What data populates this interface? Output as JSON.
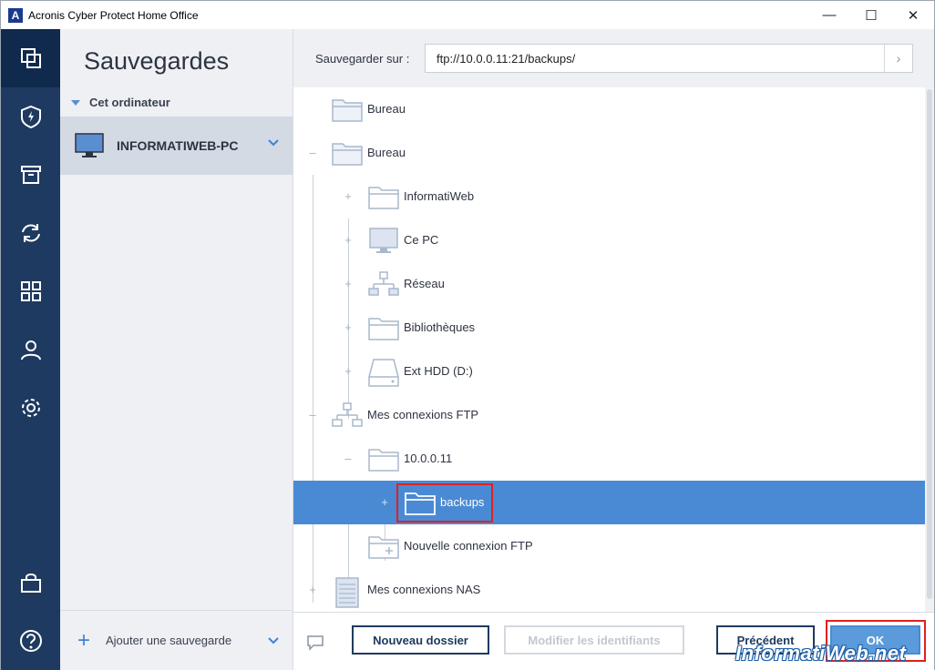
{
  "window": {
    "title": "Acronis Cyber Protect Home Office",
    "logo_letter": "A",
    "minimize": "—",
    "maximize": "☐",
    "close": "✕"
  },
  "nav": {
    "items": [
      "backup-icon",
      "protection-icon",
      "archive-icon",
      "sync-icon",
      "tools-icon",
      "account-icon",
      "settings-icon",
      "store-icon",
      "help-icon"
    ]
  },
  "backups": {
    "title": "Sauvegardes",
    "group": "Cet ordinateur",
    "computer": "INFORMATIWEB-PC",
    "add_label": "Ajouter une sauvegarde"
  },
  "destination": {
    "label": "Sauvegarder sur :",
    "value": "ftp://10.0.0.11:21/backups/"
  },
  "tree": {
    "rows": [
      {
        "label": "Bureau",
        "icon": "folder-icon"
      },
      {
        "label": "Bureau",
        "icon": "folder-icon"
      },
      {
        "label": "InformatiWeb",
        "icon": "folder-icon"
      },
      {
        "label": "Ce PC",
        "icon": "monitor-icon"
      },
      {
        "label": "Réseau",
        "icon": "network-icon"
      },
      {
        "label": "Bibliothèques",
        "icon": "folder-icon"
      },
      {
        "label": "Ext HDD (D:)",
        "icon": "drive-icon"
      },
      {
        "label": "Mes connexions FTP",
        "icon": "network-icon"
      },
      {
        "label": "10.0.0.11",
        "icon": "folder-icon"
      },
      {
        "label": "backups",
        "icon": "folder-icon"
      },
      {
        "label": "Nouvelle connexion FTP",
        "icon": "new-folder-icon"
      },
      {
        "label": "Mes connexions NAS",
        "icon": "nas-icon"
      }
    ],
    "selected": "backups"
  },
  "footer": {
    "new_folder": "Nouveau dossier",
    "edit_credentials": "Modifier les identifiants",
    "previous": "Précédent",
    "ok": "OK"
  },
  "watermark": "InformatiWeb.net",
  "colors": {
    "nav_bg": "#1e3a60",
    "selection": "#4a8ad4",
    "accent": "#3f82d4",
    "highlight": "#e02020"
  }
}
